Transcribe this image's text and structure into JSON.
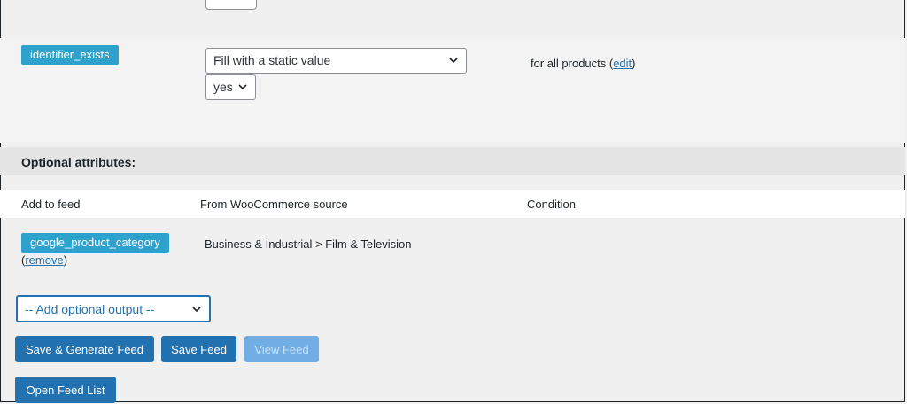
{
  "identifier": {
    "tag": "identifier_exists",
    "source_select": "Fill with a static value",
    "value_select": "yes",
    "note_prefix": "for all products (",
    "note_link": "edit",
    "note_suffix": ")"
  },
  "optional": {
    "header": "Optional attributes:",
    "columns": [
      "Add to feed",
      "From WooCommerce source",
      "Condition"
    ],
    "rows": [
      {
        "tag": "google_product_category",
        "remove_prefix": "(",
        "remove_link": "remove",
        "remove_suffix": ")",
        "source": "Business & Industrial > Film & Television"
      }
    ],
    "add_select": "-- Add optional output --"
  },
  "buttons": {
    "save_generate": "Save & Generate Feed",
    "save": "Save Feed",
    "view": "View Feed",
    "open_list": "Open Feed List"
  },
  "colors": {
    "accent": "#2271b1",
    "tag": "#2ea2cc",
    "disabled": "#72aee6"
  }
}
